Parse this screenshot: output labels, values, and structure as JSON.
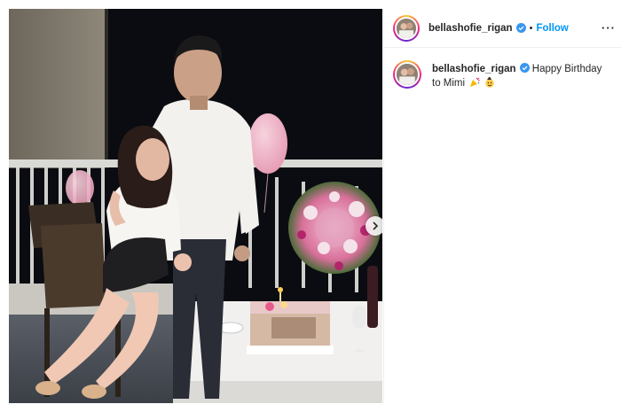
{
  "post": {
    "username": "bellashofie_rigan",
    "separator": "•",
    "follow_label": "Follow",
    "more_label": "···",
    "caption_text": "Happy Birthday to Mimi",
    "caption_emojis": [
      "party-horn-emoji",
      "party-face-emoji"
    ]
  },
  "icons": {
    "verified": "verified-badge-icon",
    "next": "chevron-right-icon",
    "more": "more-options-icon"
  },
  "colors": {
    "follow_blue": "#0095f6",
    "verified_blue": "#3897f0",
    "text": "#262626"
  }
}
